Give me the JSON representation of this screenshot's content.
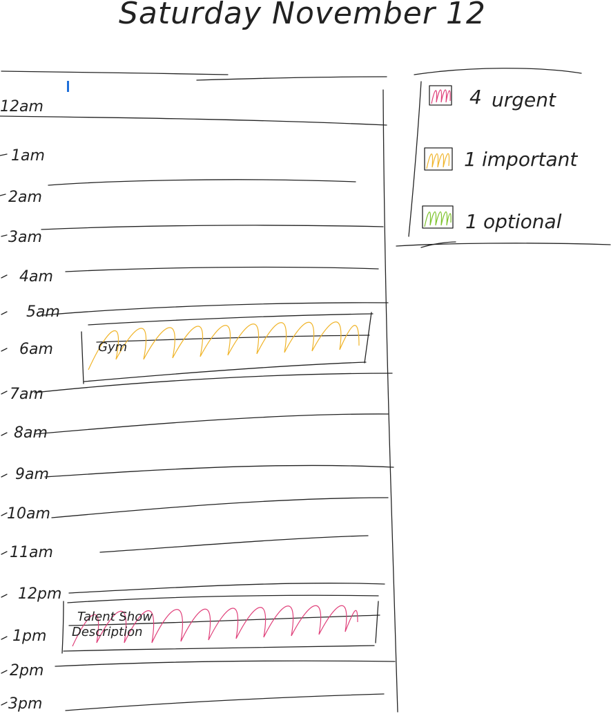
{
  "title": "Saturday November 12",
  "hours": [
    "12am",
    "1am",
    "2am",
    "3am",
    "4am",
    "5am",
    "6am",
    "7am",
    "8am",
    "9am",
    "10am",
    "11am",
    "12pm",
    "1pm",
    "2pm",
    "3pm"
  ],
  "legend": [
    {
      "count": "4",
      "label": "urgent",
      "color": "#e0407a"
    },
    {
      "count": "1",
      "label": "important",
      "color": "#f0b429"
    },
    {
      "count": "1",
      "label": "optional",
      "color": "#7cc22a"
    }
  ],
  "events": [
    {
      "label": "Gym",
      "color": "#f0b429"
    },
    {
      "label": "Talent Show",
      "label2": "Description",
      "color": "#e0407a"
    }
  ]
}
